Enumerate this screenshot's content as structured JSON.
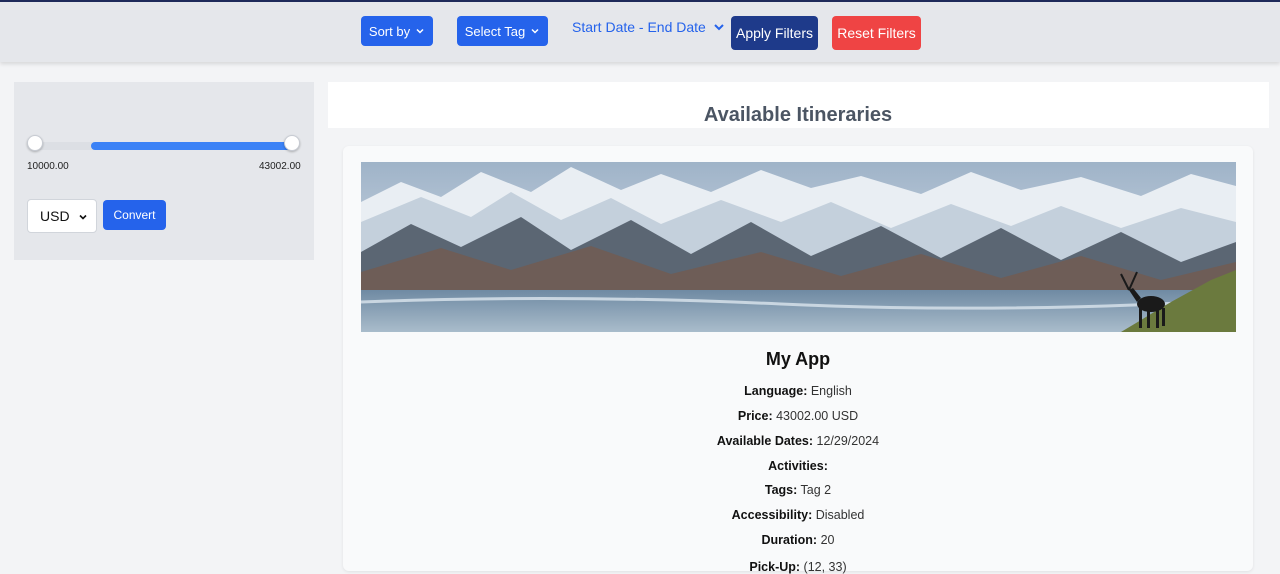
{
  "toolbar": {
    "sort_label": "Sort by",
    "tag_label": "Select Tag",
    "date_range_label": "Start Date - End Date",
    "apply_label": "Apply Filters",
    "reset_label": "Reset Filters"
  },
  "sidebar": {
    "price_slider": {
      "min_label": "10000.00",
      "max_label": "43002.00",
      "lower_fraction": 0.0,
      "upper_fraction": 1.0
    },
    "currency_value": "USD",
    "convert_label": "Convert"
  },
  "main": {
    "title": "Available Itineraries",
    "itinerary": {
      "name": "My App",
      "details": [
        {
          "label": "Language:",
          "value": "English"
        },
        {
          "label": "Price:",
          "value": "43002.00 USD"
        },
        {
          "label": "Available Dates:",
          "value": "12/29/2024"
        },
        {
          "label": "Activities:",
          "value": ""
        },
        {
          "label": "Tags:",
          "value": "Tag 2"
        },
        {
          "label": "Accessibility:",
          "value": "Disabled"
        },
        {
          "label": "Duration:",
          "value": "20"
        },
        {
          "label": "Pick-Up:",
          "value": "(12, 33)"
        }
      ]
    }
  },
  "colors": {
    "primary": "#2563eb",
    "apply": "#1e3a8a",
    "reset": "#ef4444",
    "slider_fill": "#3b82f6"
  },
  "icons": [
    "chevron-down-icon",
    "mountain-banner-image",
    "caribou-silhouette"
  ]
}
